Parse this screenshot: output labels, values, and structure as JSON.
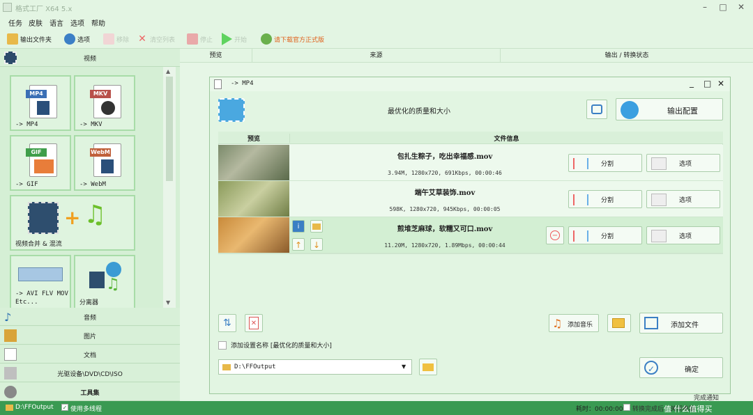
{
  "window": {
    "title": "格式工厂 X64 5.x"
  },
  "menu": [
    "任务",
    "皮肤",
    "语言",
    "选项",
    "帮助"
  ],
  "toolbar": {
    "output_folder": "输出文件夹",
    "options": "选项",
    "remove": "移除",
    "clear_list": "清空列表",
    "stop": "停止",
    "start": "开始",
    "download": "请下载官方正式版"
  },
  "left_panel": {
    "video_header": "视频",
    "tiles": [
      {
        "caption": "-> MP4",
        "tag": "MP4"
      },
      {
        "caption": "-> MKV",
        "tag": "MKV"
      },
      {
        "caption": "-> GIF",
        "tag": "GIF"
      },
      {
        "caption": "-> WebM",
        "tag": "WebM"
      },
      {
        "caption": "视频合并 & 混流"
      },
      {
        "caption": "-> AVI FLV MOV Etc..."
      },
      {
        "caption": "分离器"
      }
    ],
    "categories": [
      "音频",
      "图片",
      "文档",
      "光驱设备\\DVD\\CD\\ISO",
      "工具集"
    ]
  },
  "main_columns": {
    "preview": "预览",
    "source": "来源",
    "output": "输出 / 转换状态"
  },
  "dialog": {
    "title": "-> MP4",
    "quality": "最优化的质量和大小",
    "output_config": "输出配置",
    "col_preview": "预览",
    "col_info": "文件信息",
    "files": [
      {
        "name": "包扎生粽子，吃出幸福感.mov",
        "info": "3.94M, 1280x720, 691Kbps, 00:00:46"
      },
      {
        "name": "端午艾草装饰.mov",
        "info": "598K, 1280x720, 945Kbps, 00:00:05"
      },
      {
        "name": "煎堆芝麻球，软糯又可口.mov",
        "info": "11.20M, 1280x720, 1.89Mbps, 00:00:44"
      }
    ],
    "split": "分割",
    "option": "选项",
    "add_music": "添加音乐",
    "add_file": "添加文件",
    "add_setting_name": "添加设置名称 [最优化的质量和大小]",
    "output_path": "D:\\FFOutput",
    "ok": "确定"
  },
  "status": {
    "path": "D:\\FFOutput",
    "multithread": "使用多线程",
    "elapsed": "耗时：00:00:00",
    "after_done": "转换完成后：关闭电脑",
    "notify": "完成通知",
    "watermark": "值 什么值得买"
  }
}
